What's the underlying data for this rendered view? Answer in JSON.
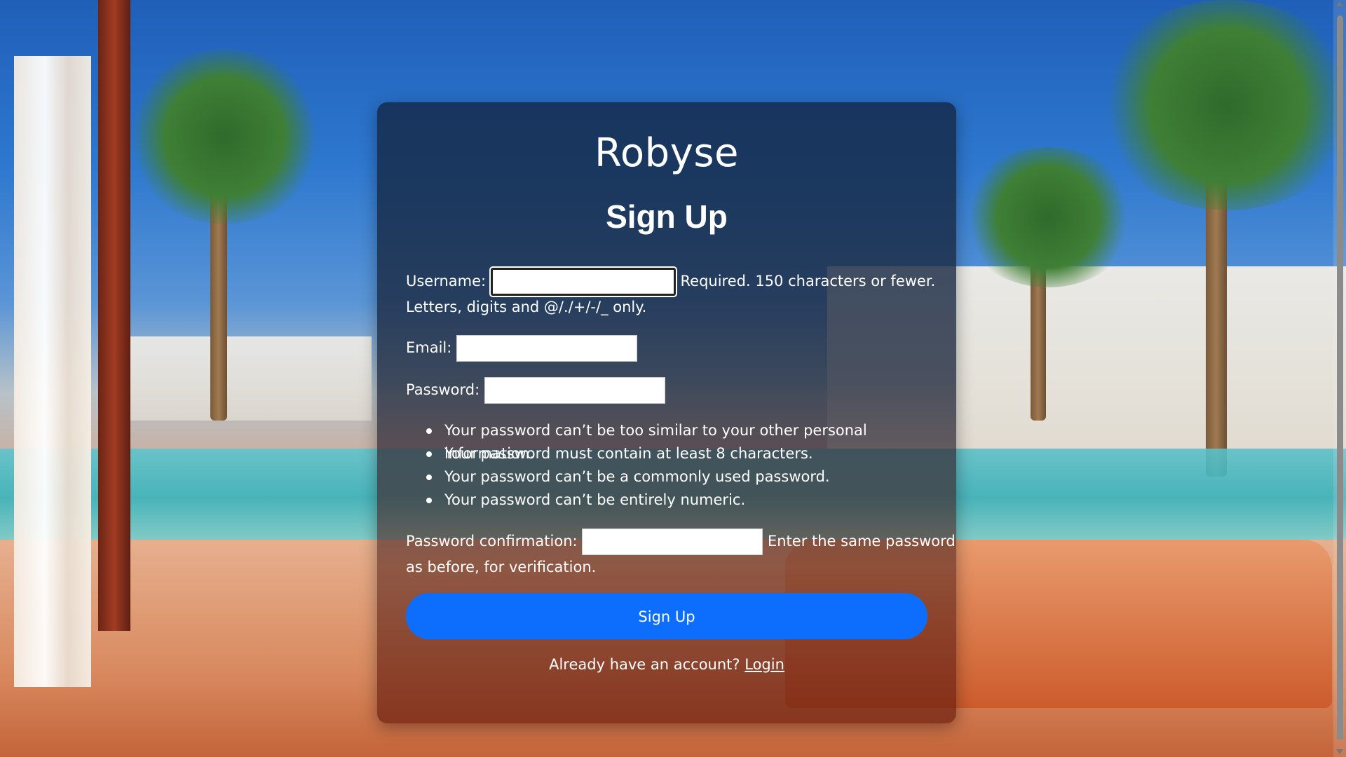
{
  "brand": "Robyse",
  "title": "Sign Up",
  "form": {
    "username_label": "Username:",
    "username_value": "",
    "username_help_1": "Required. 150 characters or fewer.",
    "username_help_2": "Letters, digits and @/./+/-/_ only.",
    "email_label": "Email:",
    "email_value": "",
    "password_label": "Password:",
    "password_value": "",
    "password_rules": [
      "Your password can’t be too similar to your other personal information.",
      "Your password must contain at least 8 characters.",
      "Your password can’t be a commonly used password.",
      "Your password can’t be entirely numeric."
    ],
    "confirm_label": "Password confirmation:",
    "confirm_value": "",
    "confirm_help_1": "Enter the same password",
    "confirm_help_2": "as before, for verification.",
    "submit_label": "Sign Up"
  },
  "footer": {
    "prompt": "Already have an account?",
    "login_label": "Login"
  },
  "colors": {
    "primary_button": "#0d6efd",
    "text": "#ffffff"
  }
}
